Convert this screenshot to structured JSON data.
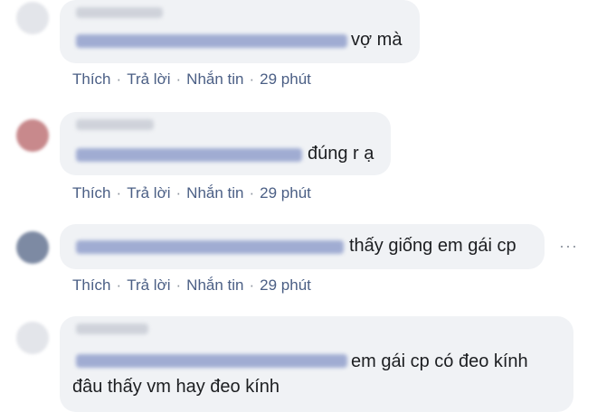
{
  "comments": [
    {
      "text": "vợ mà",
      "actions": {
        "like": "Thích",
        "reply": "Trả lời",
        "message": "Nhắn tin",
        "time": "29 phút"
      }
    },
    {
      "text": "đúng r ạ",
      "actions": {
        "like": "Thích",
        "reply": "Trả lời",
        "message": "Nhắn tin",
        "time": "29 phút"
      }
    },
    {
      "text": "thấy giống em gái cp",
      "actions": {
        "like": "Thích",
        "reply": "Trả lời",
        "message": "Nhắn tin",
        "time": "29 phút"
      },
      "more_label": "···"
    },
    {
      "text_line1": "em gái cp có đeo kính",
      "text_line2": "đâu thấy vm hay đeo kính"
    }
  ],
  "colors": {
    "bubble": "#f0f2f5",
    "action_link": "#4b5f85",
    "tag_blur": "#7f8fc4"
  }
}
